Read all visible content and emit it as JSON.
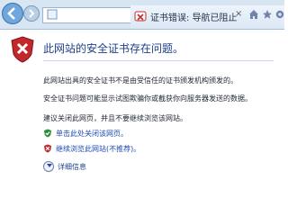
{
  "tab": {
    "title": "证书错误: 导航已阻止"
  },
  "page": {
    "heading": "此网站的安全证书存在问题。",
    "paragraphs": [
      "此网站出具的安全证书不是由受信任的证书颁发机构颁发的。",
      "安全证书问题可能显示试图欺骗你或截获你向服务器发送的数据。",
      "建议关闭此网页，并且不要继续浏览该网站。"
    ],
    "options": {
      "close": "单击此处关闭该网页。",
      "continue": "继续浏览此网站(不推荐)。"
    },
    "more_info": "详细信息"
  },
  "icons": {
    "back": "back-arrow-icon",
    "forward": "forward-arrow-icon",
    "certificate": "certificate-error-icon",
    "close": "close-icon",
    "home": "home-icon",
    "star": "star-icon",
    "gear": "gear-icon",
    "shield": "warning-shield-icon",
    "check": "green-check-shield-icon",
    "red": "red-x-shield-icon",
    "info": "chevron-down-icon"
  },
  "colors": {
    "shield_red": "#c2282a",
    "check_green": "#2e8d3a",
    "link_blue": "#1d4bb5"
  }
}
